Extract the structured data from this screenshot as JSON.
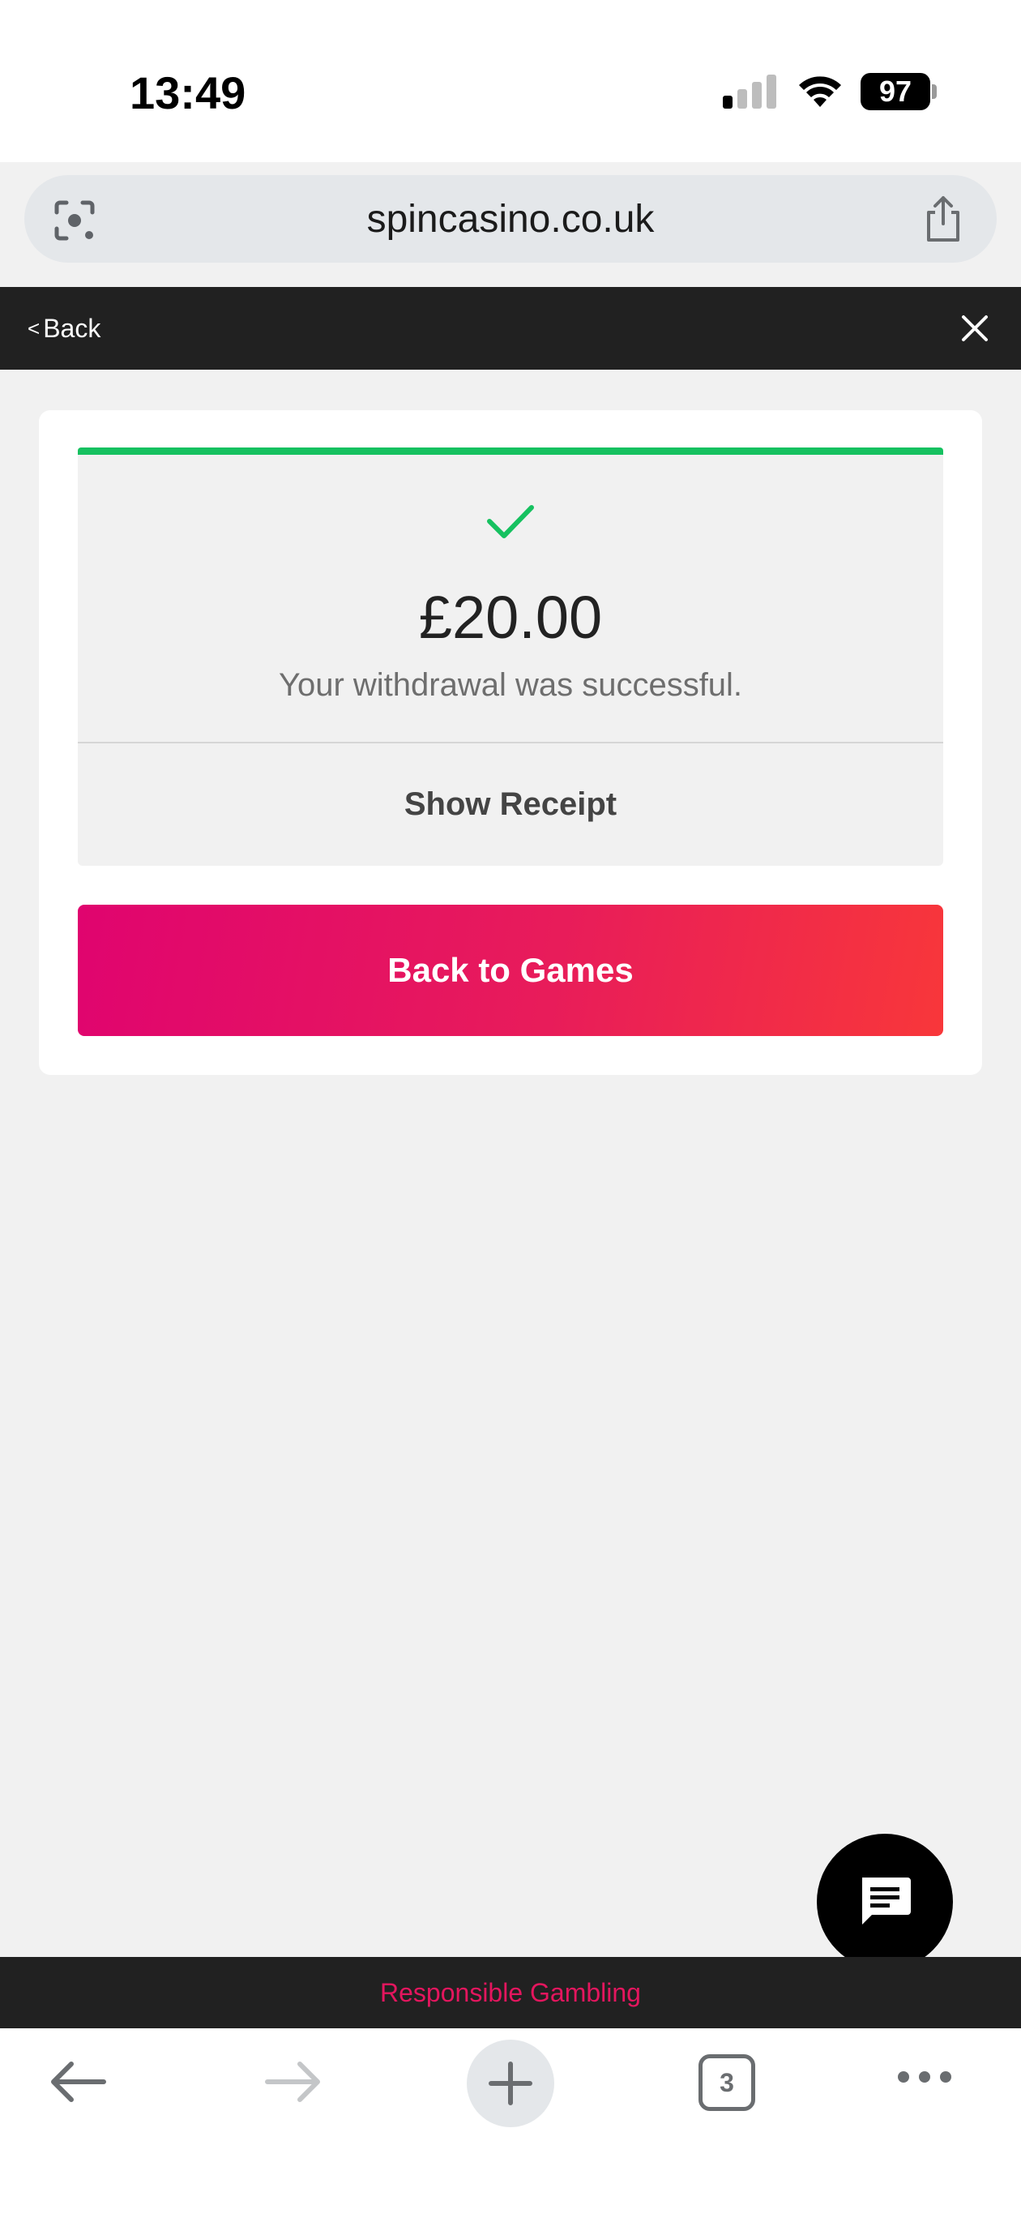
{
  "status_bar": {
    "time": "13:49",
    "battery": "97"
  },
  "browser": {
    "url": "spincasino.co.uk",
    "tab_count": "3"
  },
  "site_nav": {
    "back_label": "Back",
    "back_chevron": "<"
  },
  "result": {
    "amount": "£20.00",
    "message": "Your withdrawal was successful.",
    "receipt_label": "Show Receipt",
    "accent_color": "#16c160"
  },
  "actions": {
    "back_to_games_label": "Back to Games"
  },
  "footer": {
    "responsible_gambling_label": "Responsible Gambling"
  },
  "colors": {
    "brand_gradient_start": "#e0046f",
    "brand_gradient_end": "#f8373a",
    "nav_background": "#212121"
  },
  "icons": [
    "lens-icon",
    "share-icon",
    "close-icon",
    "check-icon",
    "chat-icon",
    "back-arrow-icon",
    "forward-arrow-icon",
    "plus-icon",
    "tabs-icon",
    "more-icon"
  ]
}
